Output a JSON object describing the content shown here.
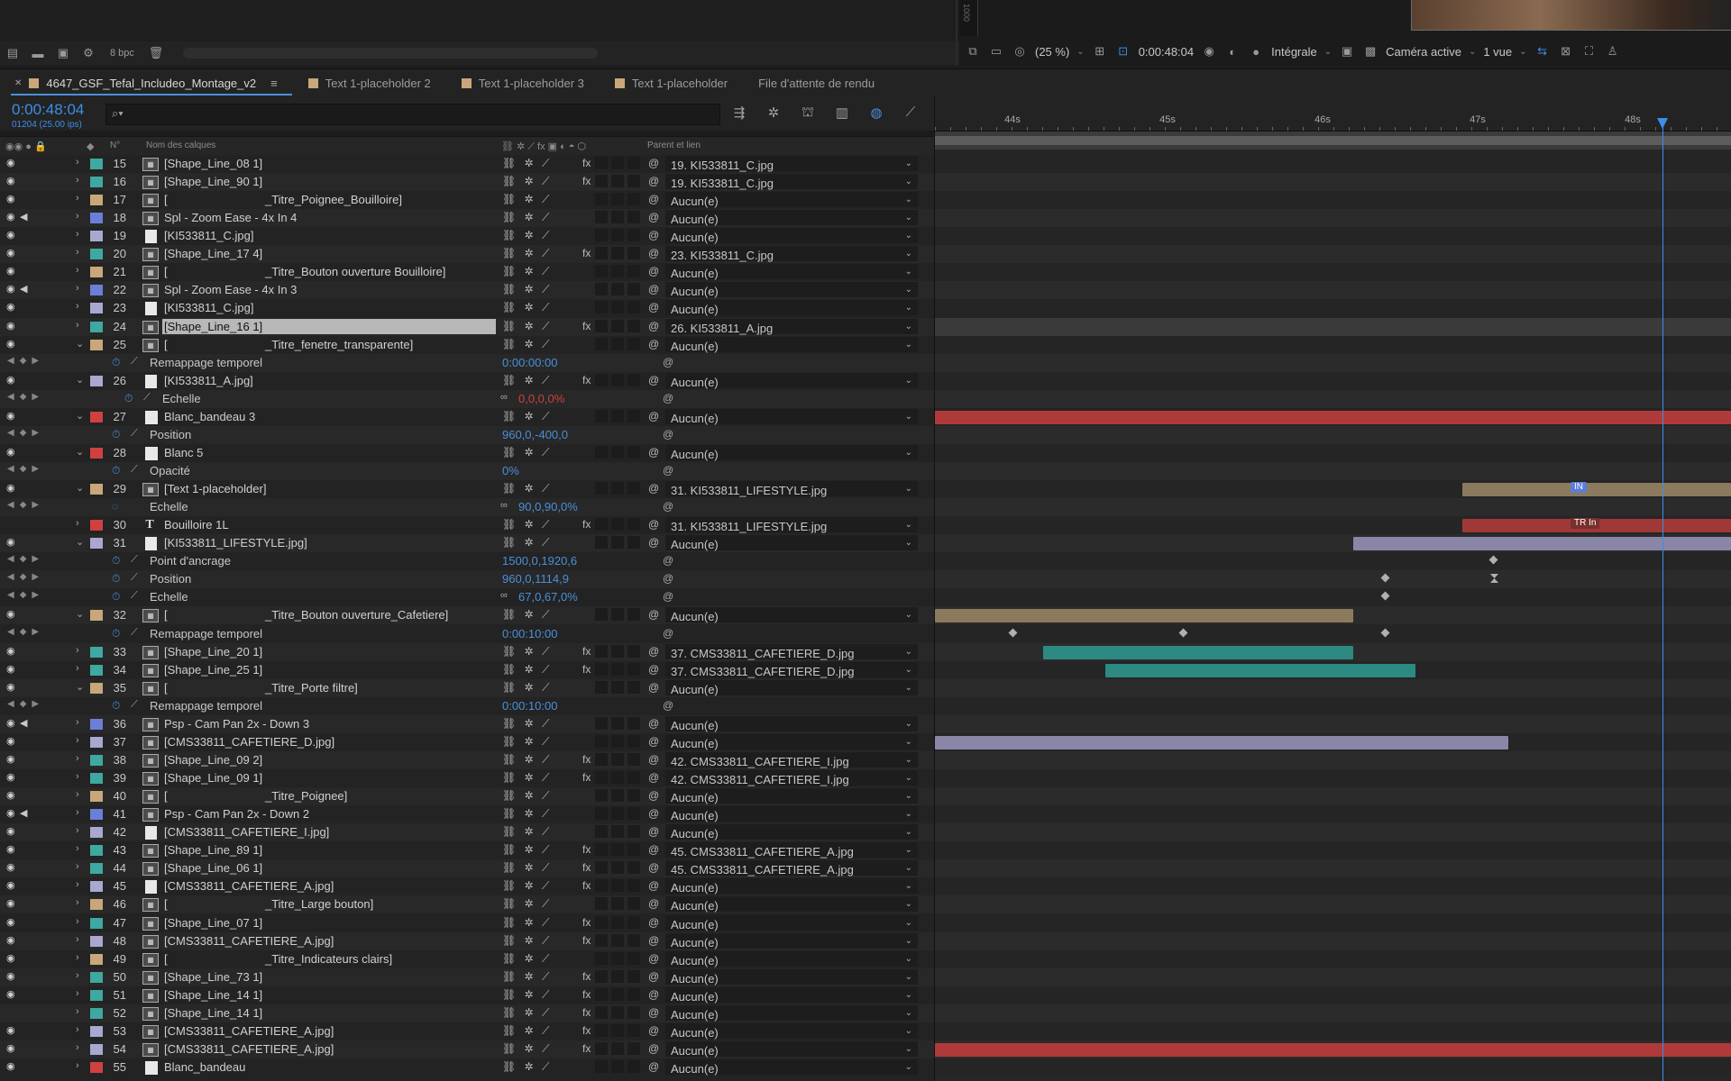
{
  "project_toolbar": {
    "bpc_label": "8 bpc"
  },
  "viewer": {
    "ruler_label": "1000",
    "zoom": "(25 %)",
    "timecode": "0:00:48:04",
    "resolution": "Intégrale",
    "camera": "Caméra active",
    "views": "1 vue"
  },
  "tabs": [
    {
      "label": "4647_GSF_Tefal_Includeo_Montage_v2",
      "color": "#c9a77a",
      "active": true
    },
    {
      "label": "Text 1-placeholder 2",
      "color": "#c9a77a",
      "active": false
    },
    {
      "label": "Text 1-placeholder 3",
      "color": "#c9a77a",
      "active": false
    },
    {
      "label": "Text 1-placeholder",
      "color": "#c9a77a",
      "active": false
    },
    {
      "label": "File d'attente de rendu",
      "color": null,
      "active": false
    }
  ],
  "timeline": {
    "current_time": "0:00:48:04",
    "frame_info": "01204 (25.00 ips)",
    "search_placeholder": "",
    "columns": {
      "number": "N°",
      "layer_name": "Nom des calques",
      "parent": "Parent et lien"
    },
    "ruler_labels": [
      "44s",
      "45s",
      "46s",
      "47s",
      "48s"
    ],
    "playhead_label": "48:04"
  },
  "rows": [
    {
      "type": "layer",
      "num": "15",
      "name": "[Shape_Line_08 1]",
      "color": "#3fa8a0",
      "icon": "comp",
      "fx": true,
      "parent": "19. KI533811_C.jpg"
    },
    {
      "type": "layer",
      "num": "16",
      "name": "[Shape_Line_90 1]",
      "color": "#3fa8a0",
      "icon": "comp",
      "fx": true,
      "parent": "19. KI533811_C.jpg"
    },
    {
      "type": "layer",
      "num": "17",
      "name": "[                              _Titre_Poignee_Bouilloire]",
      "color": "#c9a77a",
      "icon": "comp",
      "fx": false,
      "parent": "Aucun(e)"
    },
    {
      "type": "layer",
      "num": "18",
      "name": "Spl - Zoom Ease - 4x In 4",
      "color": "#6b7fd8",
      "icon": "comp",
      "fx": false,
      "parent": "Aucun(e)",
      "audio": true
    },
    {
      "type": "layer",
      "num": "19",
      "name": "[KI533811_C.jpg]",
      "color": "#a8a8d0",
      "icon": "file",
      "fx": false,
      "parent": "Aucun(e)"
    },
    {
      "type": "layer",
      "num": "20",
      "name": "[Shape_Line_17 4]",
      "color": "#3fa8a0",
      "icon": "comp",
      "fx": true,
      "parent": "23. KI533811_C.jpg"
    },
    {
      "type": "layer",
      "num": "21",
      "name": "[                              _Titre_Bouton ouverture Bouilloire]",
      "color": "#c9a77a",
      "icon": "comp",
      "fx": false,
      "parent": "Aucun(e)"
    },
    {
      "type": "layer",
      "num": "22",
      "name": "Spl - Zoom Ease - 4x In 3",
      "color": "#6b7fd8",
      "icon": "comp",
      "fx": false,
      "parent": "Aucun(e)",
      "audio": true
    },
    {
      "type": "layer",
      "num": "23",
      "name": "[KI533811_C.jpg]",
      "color": "#a8a8d0",
      "icon": "file",
      "fx": false,
      "parent": "Aucun(e)"
    },
    {
      "type": "layer",
      "num": "24",
      "name": "[Shape_Line_16 1]",
      "color": "#3fa8a0",
      "icon": "comp",
      "fx": true,
      "parent": "26. KI533811_A.jpg",
      "selected": true
    },
    {
      "type": "layer",
      "num": "25",
      "name": "[                              _Titre_fenetre_transparente]",
      "color": "#c9a77a",
      "icon": "comp",
      "fx": false,
      "parent": "Aucun(e)",
      "expanded": true
    },
    {
      "type": "prop",
      "name": "Remappage temporel",
      "value": "0:00:00:00"
    },
    {
      "type": "layer",
      "num": "26",
      "name": "[KI533811_A.jpg]",
      "color": "#a8a8d0",
      "icon": "file",
      "fx": true,
      "parent": "Aucun(e)",
      "expanded": true
    },
    {
      "type": "prop",
      "name": "Echelle",
      "value": "0,0,0,0%",
      "value_color": "red",
      "indent": true
    },
    {
      "type": "layer",
      "num": "27",
      "name": "Blanc_bandeau 3",
      "color": "#d04040",
      "icon": "solid",
      "fx": false,
      "parent": "Aucun(e)",
      "expanded": true
    },
    {
      "type": "prop",
      "name": "Position",
      "value": "960,0,-400,0"
    },
    {
      "type": "layer",
      "num": "28",
      "name": "Blanc 5",
      "color": "#d04040",
      "icon": "solid",
      "fx": false,
      "parent": "Aucun(e)",
      "expanded": true
    },
    {
      "type": "prop",
      "name": "Opacité",
      "value": "0%"
    },
    {
      "type": "layer",
      "num": "29",
      "name": "[Text 1-placeholder]",
      "color": "#c9a77a",
      "icon": "comp",
      "fx": false,
      "parent": "31. KI533811_LIFESTYLE.jpg",
      "expanded": true
    },
    {
      "type": "prop",
      "name": "Echelle",
      "value": "90,0,90,0%",
      "static": true
    },
    {
      "type": "layer",
      "num": "30",
      "name": "Bouilloire 1L",
      "color": "#d04040",
      "icon": "text",
      "fx": true,
      "parent": "31. KI533811_LIFESTYLE.jpg",
      "noeye": true
    },
    {
      "type": "layer",
      "num": "31",
      "name": "[KI533811_LIFESTYLE.jpg]",
      "color": "#a8a8d0",
      "icon": "file",
      "fx": false,
      "parent": "Aucun(e)",
      "expanded": true
    },
    {
      "type": "prop",
      "name": "Point d'ancrage",
      "value": "1500,0,1920,6"
    },
    {
      "type": "prop",
      "name": "Position",
      "value": "960,0,1114,9"
    },
    {
      "type": "prop",
      "name": "Echelle",
      "value": "67,0,67,0%"
    },
    {
      "type": "layer",
      "num": "32",
      "name": "[                              _Titre_Bouton ouverture_Cafetiere]",
      "color": "#c9a77a",
      "icon": "comp",
      "fx": false,
      "parent": "Aucun(e)",
      "expanded": true
    },
    {
      "type": "prop",
      "name": "Remappage temporel",
      "value": "0:00:10:00"
    },
    {
      "type": "layer",
      "num": "33",
      "name": "[Shape_Line_20 1]",
      "color": "#3fa8a0",
      "icon": "comp",
      "fx": true,
      "parent": "37. CMS33811_CAFETIERE_D.jpg"
    },
    {
      "type": "layer",
      "num": "34",
      "name": "[Shape_Line_25 1]",
      "color": "#3fa8a0",
      "icon": "comp",
      "fx": true,
      "parent": "37. CMS33811_CAFETIERE_D.jpg"
    },
    {
      "type": "layer",
      "num": "35",
      "name": "[                              _Titre_Porte filtre]",
      "color": "#c9a77a",
      "icon": "comp",
      "fx": false,
      "parent": "Aucun(e)",
      "expanded": true
    },
    {
      "type": "prop",
      "name": "Remappage temporel",
      "value": "0:00:10:00"
    },
    {
      "type": "layer",
      "num": "36",
      "name": "Psp - Cam Pan 2x - Down 3",
      "color": "#6b7fd8",
      "icon": "comp",
      "fx": false,
      "parent": "Aucun(e)",
      "audio": true
    },
    {
      "type": "layer",
      "num": "37",
      "name": "[CMS33811_CAFETIERE_D.jpg]",
      "color": "#a8a8d0",
      "icon": "comp",
      "fx": false,
      "parent": "Aucun(e)"
    },
    {
      "type": "layer",
      "num": "38",
      "name": "[Shape_Line_09 2]",
      "color": "#3fa8a0",
      "icon": "comp",
      "fx": true,
      "parent": "42. CMS33811_CAFETIERE_I.jpg"
    },
    {
      "type": "layer",
      "num": "39",
      "name": "[Shape_Line_09 1]",
      "color": "#3fa8a0",
      "icon": "comp",
      "fx": true,
      "parent": "42. CMS33811_CAFETIERE_I.jpg"
    },
    {
      "type": "layer",
      "num": "40",
      "name": "[                              _Titre_Poignee]",
      "color": "#c9a77a",
      "icon": "comp",
      "fx": false,
      "parent": "Aucun(e)"
    },
    {
      "type": "layer",
      "num": "41",
      "name": "Psp - Cam Pan 2x - Down 2",
      "color": "#6b7fd8",
      "icon": "comp",
      "fx": false,
      "parent": "Aucun(e)",
      "audio": true
    },
    {
      "type": "layer",
      "num": "42",
      "name": "[CMS33811_CAFETIERE_I.jpg]",
      "color": "#a8a8d0",
      "icon": "file",
      "fx": false,
      "parent": "Aucun(e)"
    },
    {
      "type": "layer",
      "num": "43",
      "name": "[Shape_Line_89 1]",
      "color": "#3fa8a0",
      "icon": "comp",
      "fx": true,
      "parent": "45. CMS33811_CAFETIERE_A.jpg"
    },
    {
      "type": "layer",
      "num": "44",
      "name": "[Shape_Line_06 1]",
      "color": "#3fa8a0",
      "icon": "comp",
      "fx": true,
      "parent": "45. CMS33811_CAFETIERE_A.jpg"
    },
    {
      "type": "layer",
      "num": "45",
      "name": "[CMS33811_CAFETIERE_A.jpg]",
      "color": "#a8a8d0",
      "icon": "file",
      "fx": true,
      "parent": "Aucun(e)"
    },
    {
      "type": "layer",
      "num": "46",
      "name": "[                              _Titre_Large bouton]",
      "color": "#c9a77a",
      "icon": "comp",
      "fx": false,
      "parent": "Aucun(e)"
    },
    {
      "type": "layer",
      "num": "47",
      "name": "[Shape_Line_07 1]",
      "color": "#3fa8a0",
      "icon": "comp",
      "fx": true,
      "parent": "Aucun(e)"
    },
    {
      "type": "layer",
      "num": "48",
      "name": "[CMS33811_CAFETIERE_A.jpg]",
      "color": "#a8a8d0",
      "icon": "comp",
      "fx": true,
      "parent": "Aucun(e)"
    },
    {
      "type": "layer",
      "num": "49",
      "name": "[                              _Titre_Indicateurs clairs]",
      "color": "#c9a77a",
      "icon": "comp",
      "fx": false,
      "parent": "Aucun(e)"
    },
    {
      "type": "layer",
      "num": "50",
      "name": "[Shape_Line_73 1]",
      "color": "#3fa8a0",
      "icon": "comp",
      "fx": true,
      "parent": "Aucun(e)"
    },
    {
      "type": "layer",
      "num": "51",
      "name": "[Shape_Line_14 1]",
      "color": "#3fa8a0",
      "icon": "comp",
      "fx": true,
      "parent": "Aucun(e)"
    },
    {
      "type": "layer",
      "num": "52",
      "name": "[Shape_Line_14 1]",
      "color": "#3fa8a0",
      "icon": "comp",
      "fx": true,
      "parent": "Aucun(e)",
      "noeye": true
    },
    {
      "type": "layer",
      "num": "53",
      "name": "[CMS33811_CAFETIERE_A.jpg]",
      "color": "#a8a8d0",
      "icon": "comp",
      "fx": true,
      "parent": "Aucun(e)"
    },
    {
      "type": "layer",
      "num": "54",
      "name": "[CMS33811_CAFETIERE_A.jpg]",
      "color": "#a8a8d0",
      "icon": "comp",
      "fx": true,
      "parent": "Aucun(e)"
    },
    {
      "type": "layer",
      "num": "55",
      "name": "Blanc_bandeau",
      "color": "#d04040",
      "icon": "solid",
      "fx": false,
      "parent": "Aucun(e)"
    }
  ],
  "clips": [
    {
      "row": 14,
      "start": "start",
      "end": "end",
      "color": "#b03a3a"
    },
    {
      "row": 18,
      "start": "46.9s",
      "end": "end",
      "color": "#8c7a5e",
      "marker": "IN",
      "marker_at": "47.6s",
      "marker_color": "#5b7cd8"
    },
    {
      "row": 20,
      "start": "46.9s",
      "end": "end",
      "color": "#a03838",
      "marker": "TR In",
      "marker_at": "47.6s",
      "marker_color": "#7a2f2f"
    },
    {
      "row": 21,
      "start": "46.2s",
      "end": "end",
      "color": "#8a86a8"
    },
    {
      "row": 25,
      "start": "start",
      "end": "46.2s",
      "color": "#8c7a5e"
    },
    {
      "row": 27,
      "start": "44.2s",
      "end": "46.2s",
      "color": "#2c8a82"
    },
    {
      "row": 28,
      "start": "44.6s",
      "end": "46.6s",
      "color": "#2c8a82"
    },
    {
      "row": 32,
      "start": "start",
      "end": "47.2s",
      "color": "#8a86a8"
    },
    {
      "row": 49,
      "start": "start",
      "end": "end",
      "color": "#b03a3a"
    }
  ],
  "keyframes": [
    {
      "row": 22,
      "at": "47.1s"
    },
    {
      "row": 23,
      "at": "46.4s"
    },
    {
      "row": 23,
      "at": "47.1s",
      "shape": "hourglass"
    },
    {
      "row": 24,
      "at": "46.4s"
    },
    {
      "row": 26,
      "at": "44.0s"
    },
    {
      "row": 26,
      "at": "45.1s"
    },
    {
      "row": 26,
      "at": "46.4s"
    }
  ]
}
